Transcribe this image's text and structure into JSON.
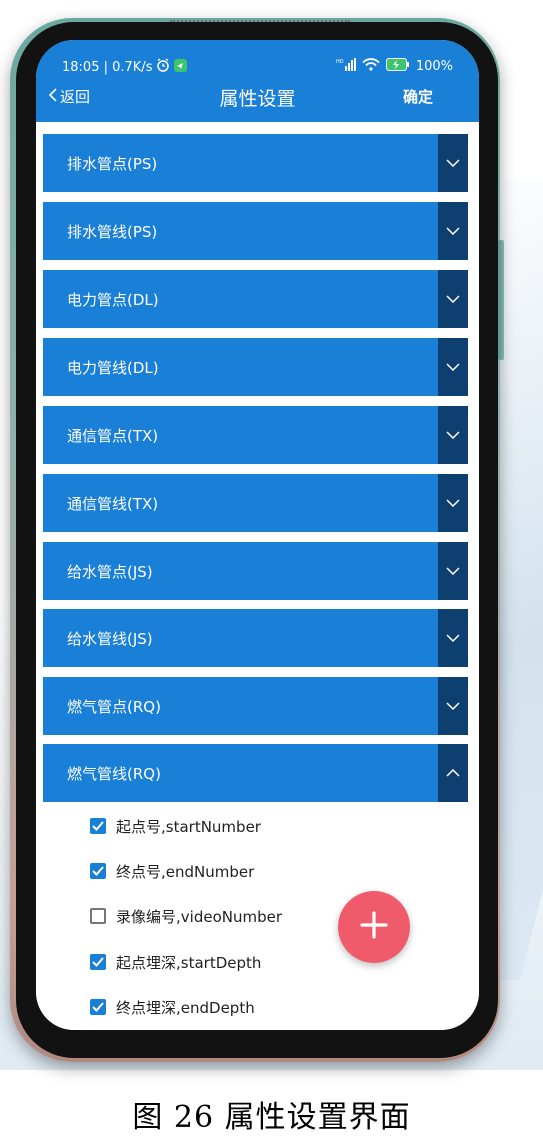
{
  "status": {
    "time_speed": "18:05 | 0.7K/s",
    "alarm_icon": "alarm-clock-icon",
    "notify_icon": "message-app-icon",
    "signal_icon": "signal-icon",
    "wifi_icon": "wifi-icon",
    "battery_icon": "battery-charging-icon",
    "battery": "100%"
  },
  "header": {
    "back_label": "返回",
    "title": "属性设置",
    "confirm_label": "确定"
  },
  "sections": [
    {
      "label": "排水管点(PS)",
      "expanded": false
    },
    {
      "label": "排水管线(PS)",
      "expanded": false
    },
    {
      "label": "电力管点(DL)",
      "expanded": false
    },
    {
      "label": "电力管线(DL)",
      "expanded": false
    },
    {
      "label": "通信管点(TX)",
      "expanded": false
    },
    {
      "label": "通信管线(TX)",
      "expanded": false
    },
    {
      "label": "给水管点(JS)",
      "expanded": false
    },
    {
      "label": "给水管线(JS)",
      "expanded": false
    },
    {
      "label": "燃气管点(RQ)",
      "expanded": false
    },
    {
      "label": "燃气管线(RQ)",
      "expanded": true
    }
  ],
  "fields": [
    {
      "label": "起点号,startNumber",
      "checked": true
    },
    {
      "label": "终点号,endNumber",
      "checked": true
    },
    {
      "label": "录像编号,videoNumber",
      "checked": false
    },
    {
      "label": "起点埋深,startDepth",
      "checked": true
    },
    {
      "label": "终点埋深,endDepth",
      "checked": true
    }
  ],
  "fab_icon": "plus-icon",
  "caption": "图 26 属性设置界面",
  "colors": {
    "primary": "#1a7fd6",
    "chevron_bg": "#0d3f70",
    "fab": "#ef5b6a"
  }
}
